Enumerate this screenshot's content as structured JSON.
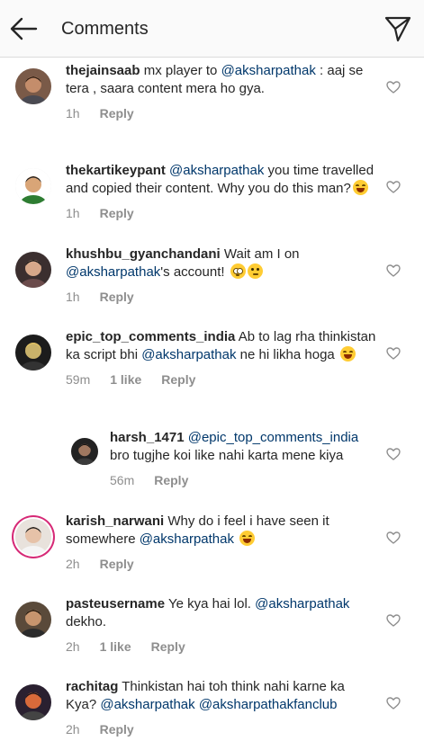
{
  "header": {
    "title": "Comments"
  },
  "comments": [
    {
      "username": "thejainsaab",
      "text_parts": [
        " mx player to ",
        {
          "mention": "@aksharpathak"
        },
        " : aaj se tera , saara content mera ho gya."
      ],
      "time": "1h",
      "likes": "",
      "reply_label": "Reply",
      "avatar": {
        "bg": "#7a5a48",
        "skin": "#c48d6b",
        "hair": "#2a1a10",
        "shirt": "#4a4a52"
      }
    },
    {
      "username": "thekartikeypant",
      "text_parts": [
        " ",
        {
          "mention": "@aksharpathak"
        },
        " you time travelled and copied their content. Why you do this man?",
        {
          "emoji": "laugh"
        }
      ],
      "time": "1h",
      "likes": "",
      "reply_label": "Reply",
      "avatar": {
        "bg": "#ffffff",
        "skin": "#d9a577",
        "hair": "#1f1f1f",
        "shirt": "#2e7d32"
      }
    },
    {
      "username": "khushbu_gyanchandani",
      "text_parts": [
        " Wait am I on ",
        {
          "mention": "@aksharpathak"
        },
        "'s account! ",
        {
          "emoji": "flush"
        },
        {
          "emoji": "think"
        }
      ],
      "time": "1h",
      "likes": "",
      "reply_label": "Reply",
      "avatar": {
        "bg": "#3b2f2f",
        "skin": "#d7a88a",
        "hair": "#111111",
        "shirt": "#6b4b4b"
      }
    },
    {
      "username": "epic_top_comments_india",
      "text_parts": [
        " Ab to lag rha thinkistan ka script bhi ",
        {
          "mention": "@aksharpathak"
        },
        " ne hi likha hoga ",
        {
          "emoji": "laugh"
        }
      ],
      "time": "59m",
      "likes": "1 like",
      "reply_label": "Reply",
      "avatar": {
        "bg": "#1c1c1c",
        "skin": "#c9b26a",
        "hair": "#e0c060",
        "shirt": "#333333"
      }
    },
    {
      "reply": true,
      "username": "harsh_1471",
      "text_parts": [
        " ",
        {
          "mention": "@epic_top_comments_india"
        },
        " bro tugjhe koi like nahi karta mene kiya"
      ],
      "time": "56m",
      "likes": "",
      "reply_label": "Reply",
      "avatar": {
        "bg": "#222222",
        "skin": "#a07860",
        "hair": "#0f0f0f",
        "shirt": "#3a3a3a"
      }
    },
    {
      "username": "karish_narwani",
      "text_parts": [
        " Why do i feel i have seen it somewhere ",
        {
          "mention": "@aksharpathak"
        },
        " ",
        {
          "emoji": "laugh"
        }
      ],
      "time": "2h",
      "likes": "",
      "reply_label": "Reply",
      "story_ring": true,
      "avatar": {
        "bg": "#e8e2dc",
        "skin": "#e6c2a8",
        "hair": "#1a1a1a",
        "shirt": "#f5f5f5"
      }
    },
    {
      "username": "pasteusername",
      "text_parts": [
        " Ye kya hai lol. ",
        {
          "mention": "@aksharpathak"
        },
        " dekho."
      ],
      "time": "2h",
      "likes": "1 like",
      "reply_label": "Reply",
      "avatar": {
        "bg": "#5a4a3a",
        "skin": "#c7956e",
        "hair": "#1a1208",
        "shirt": "#2b2b2b"
      }
    },
    {
      "username": "rachitag",
      "text_parts": [
        " Thinkistan hai toh think nahi karne ka Kya? ",
        {
          "mention": "@aksharpathak"
        },
        " ",
        {
          "mention": "@aksharpathakfanclub"
        }
      ],
      "time": "2h",
      "likes": "",
      "reply_label": "Reply",
      "avatar": {
        "bg": "#2a2030",
        "skin": "#d86a3a",
        "hair": "#101018",
        "shirt": "#444444"
      }
    }
  ]
}
